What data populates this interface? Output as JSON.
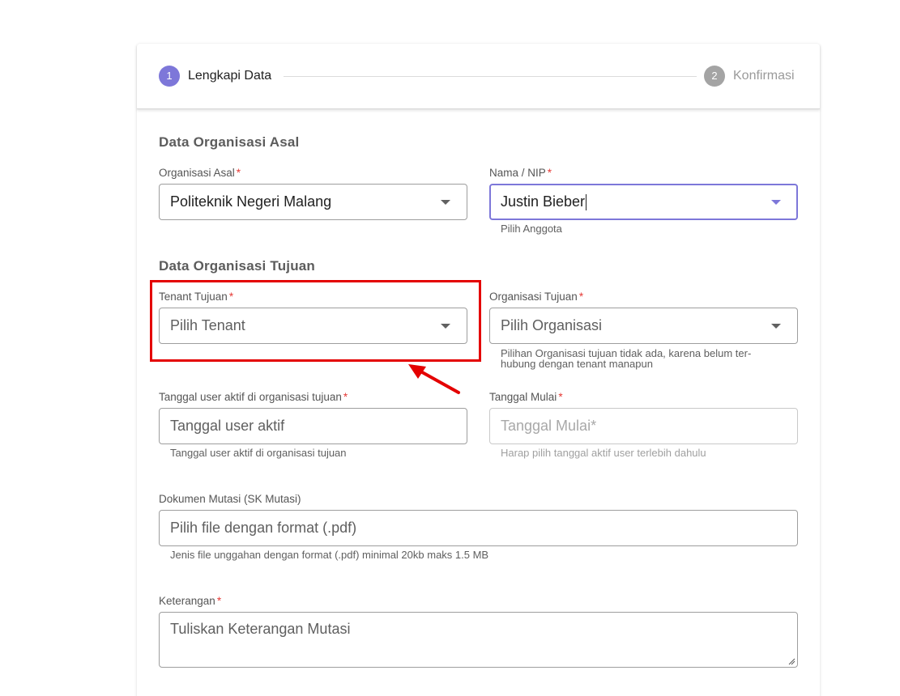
{
  "stepper": {
    "step1": {
      "number": "1",
      "label": "Lengkapi Data"
    },
    "step2": {
      "number": "2",
      "label": "Konfirmasi"
    }
  },
  "sections": {
    "asal_title": "Data Organisasi Asal",
    "tujuan_title": "Data Organisasi Tujuan"
  },
  "required_mark": "*",
  "fields": {
    "organisasi_asal": {
      "label": "Organisasi Asal",
      "value": "Politeknik Negeri Malang"
    },
    "nama_nip": {
      "label": "Nama / NIP",
      "value": "Justin Bieber",
      "hint": "Pilih Anggota"
    },
    "tenant_tujuan": {
      "label": "Tenant Tujuan",
      "placeholder": "Pilih Tenant"
    },
    "organisasi_tujuan": {
      "label": "Organisasi Tujuan",
      "placeholder": "Pilih Organisasi",
      "hint_line1": "Pilihan Organisasi tujuan tidak ada, karena belum ter-",
      "hint_line2": "hubung dengan tenant manapun"
    },
    "tanggal_user_aktif": {
      "label": "Tanggal user aktif di organisasi tujuan",
      "placeholder": "Tanggal user aktif",
      "hint": "Tanggal user aktif di organisasi tujuan"
    },
    "tanggal_mulai": {
      "label": "Tanggal Mulai",
      "placeholder": "Tanggal Mulai*",
      "hint": "Harap pilih tanggal aktif user terlebih dahulu"
    },
    "dokumen_mutasi": {
      "label": "Dokumen Mutasi (SK Mutasi)",
      "placeholder": "Pilih file dengan format (.pdf)",
      "hint": "Jenis file unggahan dengan format (.pdf) minimal 20kb maks 1.5 MB"
    },
    "keterangan": {
      "label": "Keterangan",
      "placeholder": "Tuliskan Keterangan Mutasi"
    }
  },
  "colors": {
    "accent": "#7d77d9",
    "required": "#e53935",
    "annotation": "#e40000"
  }
}
